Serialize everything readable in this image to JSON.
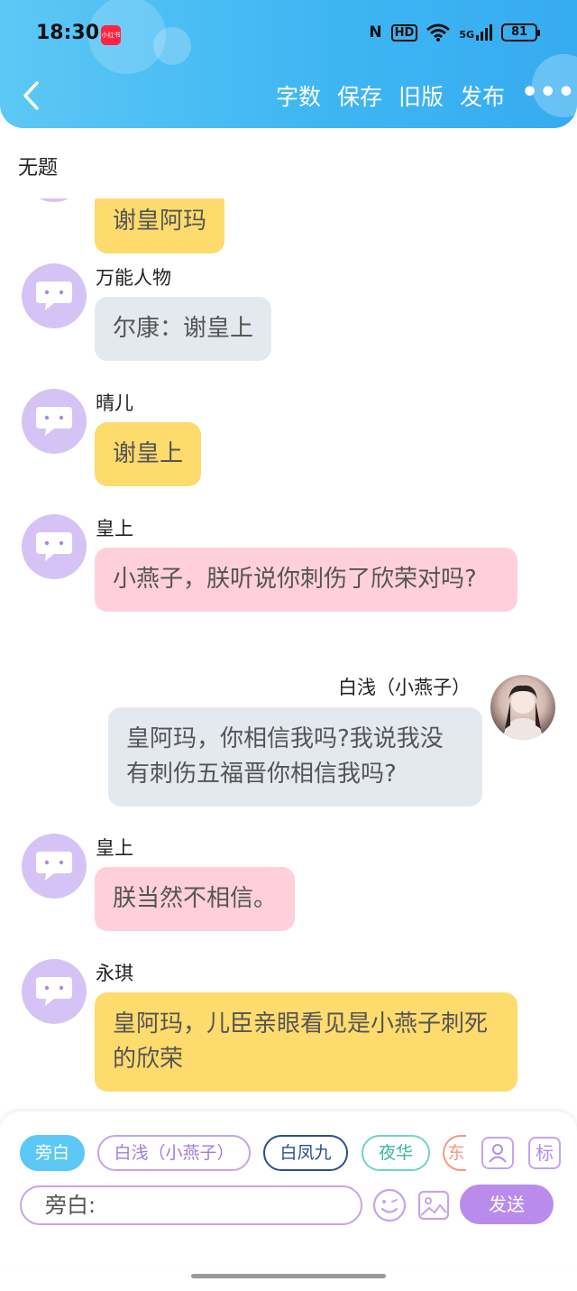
{
  "status_bar": {
    "time": "18:30",
    "app_badge": "小红书",
    "nfc": "N",
    "hd": "HD",
    "signal": "5G",
    "battery": "81"
  },
  "nav": {
    "back_icon": "chevron-left-icon",
    "actions": [
      "字数",
      "保存",
      "旧版",
      "发布"
    ],
    "more": "•••"
  },
  "doc_title": "无题",
  "messages": [
    {
      "name": "",
      "text": "谢皇阿玛",
      "color": "#fedb6d",
      "side": "left"
    },
    {
      "name": "万能人物",
      "text": "尔康：谢皇上",
      "color": "#e4e9f0",
      "side": "left"
    },
    {
      "name": "晴儿",
      "text": "谢皇上",
      "color": "#fedb6d",
      "side": "left"
    },
    {
      "name": "皇上",
      "text": "小燕子，朕听说你刺伤了欣荣对吗?",
      "color": "#ffd0dc",
      "side": "left"
    },
    {
      "name": "白浅（小燕子）",
      "text": "皇阿玛，你相信我吗?我说我没有刺伤五福晋你相信我吗?",
      "color": "#e4e9f0",
      "side": "right"
    },
    {
      "name": "皇上",
      "text": "朕当然不相信。",
      "color": "#ffd0dc",
      "side": "left"
    },
    {
      "name": "永琪",
      "text": "皇阿玛，儿臣亲眼看见是小燕子刺死的欣荣",
      "color": "#fedb6d",
      "side": "left"
    }
  ],
  "composer": {
    "chips": [
      "旁白",
      "白浅（小燕子）",
      "白凤九",
      "夜华",
      "东"
    ],
    "profile_icon": "person-card-icon",
    "tag_label": "标",
    "input_value": "旁白:",
    "emoji_icon": "smile-icon",
    "image_icon": "image-icon",
    "send_label": "发送"
  },
  "colors": {
    "header": "#3fb6f3",
    "accent_purple": "#b98cec",
    "bubble_yellow": "#fedb6d",
    "bubble_gray": "#e4e9f0",
    "bubble_pink": "#ffd0dc"
  }
}
